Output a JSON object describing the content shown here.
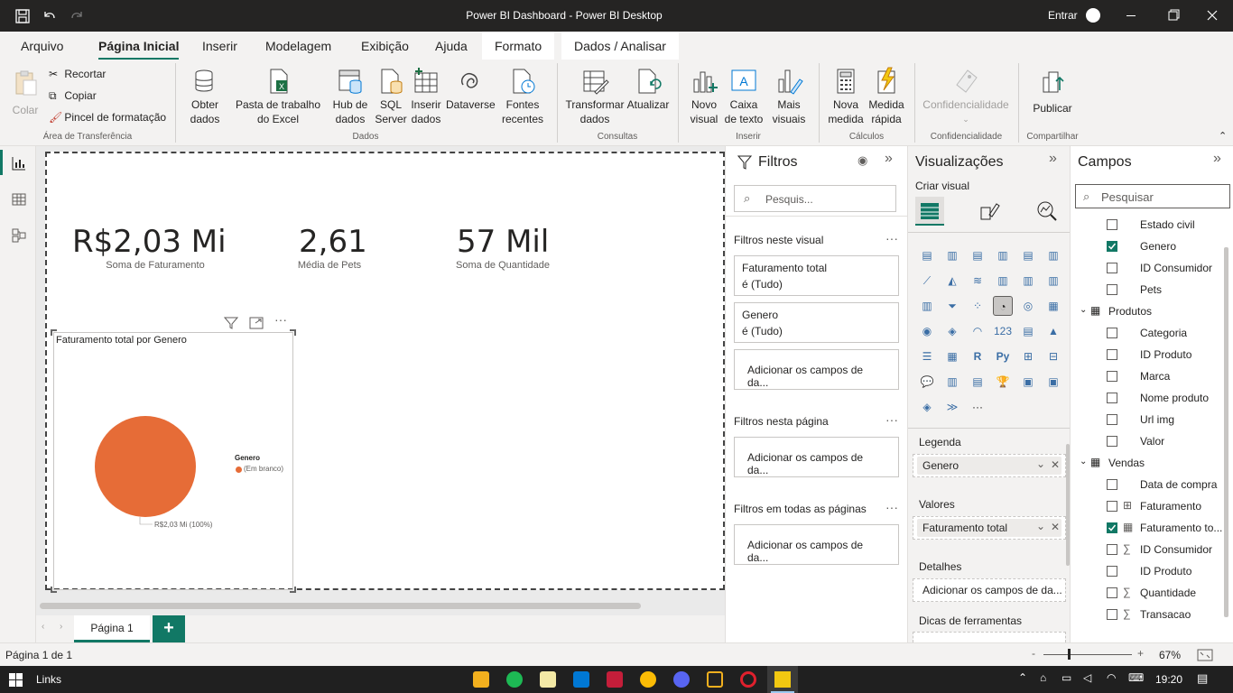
{
  "window": {
    "title": "Power BI Dashboard - Power BI Desktop",
    "signin_label": "Entrar"
  },
  "menu": {
    "tabs": [
      "Arquivo",
      "Página Inicial",
      "Inserir",
      "Modelagem",
      "Exibição",
      "Ajuda",
      "Formato",
      "Dados / Analisar"
    ],
    "active": "Página Inicial"
  },
  "ribbon": {
    "clipboard": {
      "paste": "Colar",
      "cut": "Recortar",
      "copy": "Copiar",
      "format_painter": "Pincel de formatação",
      "group": "Área de Transferência"
    },
    "data": {
      "get_data": "Obter dados",
      "excel": "Pasta de trabalho do Excel",
      "hub": "Hub de dados",
      "sql": "SQL Server",
      "enter_data": "Inserir dados",
      "dataverse": "Dataverse",
      "recent": "Fontes recentes",
      "group": "Dados"
    },
    "queries": {
      "transform": "Transformar dados",
      "refresh": "Atualizar",
      "group": "Consultas"
    },
    "insert": {
      "new_visual": "Novo visual",
      "text_box": "Caixa de texto",
      "more_visuals": "Mais visuais",
      "group": "Inserir"
    },
    "calc": {
      "new_measure": "Nova medida",
      "quick_measure": "Medida rápida",
      "group": "Cálculos"
    },
    "sensitivity": {
      "label": "Confidencialidade",
      "group": "Confidencialidade"
    },
    "share": {
      "publish": "Publicar",
      "group": "Compartilhar"
    }
  },
  "cards": [
    {
      "value": "R$2,03 Mi",
      "label": "Soma de Faturamento"
    },
    {
      "value": "2,61",
      "label": "Média de Pets"
    },
    {
      "value": "57 Mil",
      "label": "Soma de Quantidade"
    }
  ],
  "pie_visual": {
    "title": "Faturamento total por Genero",
    "legend_title": "Genero",
    "legend_item": "(Em branco)",
    "data_label": "R$2,03 Mi (100%)",
    "slice_color": "#E66C37"
  },
  "chart_data": {
    "type": "pie",
    "title": "Faturamento total por Genero",
    "categories": [
      "(Em branco)"
    ],
    "values": [
      2030000
    ],
    "labels": [
      "R$2,03 Mi (100%)"
    ],
    "legend_title": "Genero",
    "legend_placement": "right"
  },
  "page_tabs": {
    "current": "Página 1",
    "add": "+"
  },
  "filters": {
    "title": "Filtros",
    "search_placeholder": "Pesquis...",
    "visual_section": "Filtros neste visual",
    "visual_filters": [
      {
        "field": "Faturamento total",
        "state": "é (Tudo)"
      },
      {
        "field": "Genero",
        "state": "é (Tudo)"
      }
    ],
    "add_fields": "Adicionar os campos de da...",
    "page_section": "Filtros nesta página",
    "all_pages_section": "Filtros em todas as páginas"
  },
  "visualizations": {
    "title": "Visualizações",
    "build_visual": "Criar visual",
    "legend_label": "Legenda",
    "legend_field": "Genero",
    "values_label": "Valores",
    "values_field": "Faturamento total",
    "details_label": "Detalhes",
    "details_placeholder": "Adicionar os campos de da...",
    "tooltips_label": "Dicas de ferramentas",
    "r_label": "R",
    "py_label": "Py",
    "more": "···"
  },
  "fields": {
    "title": "Campos",
    "search_placeholder": "Pesquisar",
    "items": [
      {
        "name": "Estado civil",
        "checked": false,
        "kind": "field"
      },
      {
        "name": "Genero",
        "checked": true,
        "kind": "field"
      },
      {
        "name": "ID Consumidor",
        "checked": false,
        "kind": "field"
      },
      {
        "name": "Pets",
        "checked": false,
        "kind": "field"
      },
      {
        "name": "Produtos",
        "kind": "table"
      },
      {
        "name": "Categoria",
        "checked": false,
        "kind": "field"
      },
      {
        "name": "ID Produto",
        "checked": false,
        "kind": "field"
      },
      {
        "name": "Marca",
        "checked": false,
        "kind": "field"
      },
      {
        "name": "Nome produto",
        "checked": false,
        "kind": "field"
      },
      {
        "name": "Url img",
        "checked": false,
        "kind": "field"
      },
      {
        "name": "Valor",
        "checked": false,
        "kind": "field"
      },
      {
        "name": "Vendas",
        "kind": "table"
      },
      {
        "name": "Data de compra",
        "checked": false,
        "kind": "field"
      },
      {
        "name": "Faturamento",
        "checked": false,
        "kind": "column"
      },
      {
        "name": "Faturamento to...",
        "checked": true,
        "kind": "measure"
      },
      {
        "name": "ID Consumidor",
        "checked": false,
        "kind": "sum"
      },
      {
        "name": "ID Produto",
        "checked": false,
        "kind": "field"
      },
      {
        "name": "Quantidade",
        "checked": false,
        "kind": "sum"
      },
      {
        "name": "Transacao",
        "checked": false,
        "kind": "sum"
      }
    ]
  },
  "status": {
    "page_info": "Página 1 de 1",
    "zoom_minus": "-",
    "zoom_plus": "+",
    "zoom": "67%"
  },
  "taskbar": {
    "links_label": "Links",
    "time": "19:20"
  },
  "colors": {
    "accent": "#117865",
    "pie": "#E66C37",
    "titlebar": "#252423"
  }
}
